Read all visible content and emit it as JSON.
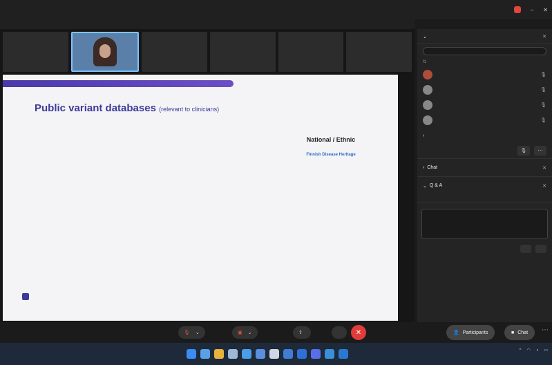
{
  "colors": {
    "accent": "#3d3a9a",
    "end_call": "#e23b3b",
    "slide_bar": "#4a3aa8",
    "link_blue": "#2d6cc0"
  },
  "titlebar": {
    "app_title": "",
    "item2": "",
    "item3": ""
  },
  "menubar": {
    "items": [
      "",
      "",
      "",
      "",
      "",
      "",
      ""
    ]
  },
  "participant_tiles": [
    {
      "name": "",
      "sub": ""
    },
    {
      "name": "",
      "sub": "",
      "active": true
    },
    {
      "name": "",
      "sub": ""
    },
    {
      "name": "",
      "sub": ""
    },
    {
      "name": "",
      "sub": ""
    },
    {
      "name": "",
      "sub": ""
    }
  ],
  "slide": {
    "title": "Public variant databases",
    "subtitle": "(relevant to clinicians)",
    "columns": [
      {
        "heading": "",
        "items": [
          "",
          "",
          "",
          ""
        ]
      },
      {
        "heading": "",
        "items": [
          "",
          "",
          ""
        ]
      },
      {
        "heading": "",
        "items": [
          "",
          "",
          "",
          "",
          ""
        ]
      }
    ],
    "national": {
      "heading": "National / Ethnic",
      "item1_link": "Finnish Disease Heritage",
      "item1_text": "",
      "item2_link": "",
      "item2_text": ""
    },
    "footer_left": "",
    "footer_mid": "",
    "footer_right": ""
  },
  "controls": {
    "mute": "",
    "start_video": "",
    "share": "",
    "participants": "Participants",
    "chat": "Chat"
  },
  "panel": {
    "participants_title": "",
    "search_placeholder": "",
    "sort_label": "",
    "participants": [
      {
        "name": ""
      },
      {
        "name": ""
      },
      {
        "name": ""
      },
      {
        "name": ""
      }
    ],
    "attendees": "",
    "chat_title": "Chat",
    "qa_title": "Q & A",
    "qa_tab": "",
    "qa_input_placeholder": ""
  }
}
